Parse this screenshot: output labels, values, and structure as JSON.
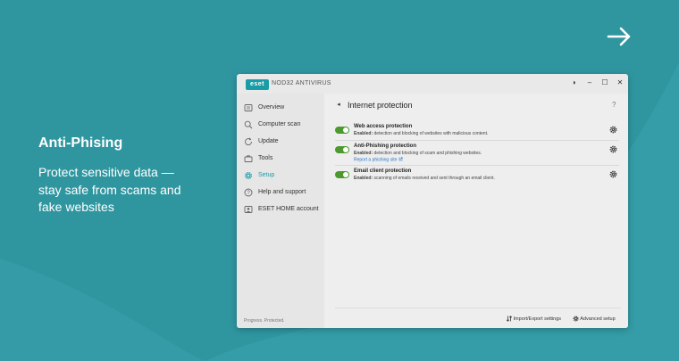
{
  "promo": {
    "title": "Anti-Phising",
    "text": "Protect sensitive data —stay safe from scams and fake websites"
  },
  "icons": {
    "next": "arrow-right-icon"
  },
  "app": {
    "logo": "eset",
    "product_name": "NOD32 ANTIVIRUS",
    "window_controls": [
      "◑",
      "–",
      "☐",
      "✕"
    ],
    "sidebar": {
      "items": [
        {
          "label": "Overview",
          "icon": "overview-icon",
          "active": false
        },
        {
          "label": "Computer scan",
          "icon": "search-icon",
          "active": false
        },
        {
          "label": "Update",
          "icon": "refresh-icon",
          "active": false
        },
        {
          "label": "Tools",
          "icon": "briefcase-icon",
          "active": false
        },
        {
          "label": "Setup",
          "icon": "gear-icon",
          "active": true
        },
        {
          "label": "Help and support",
          "icon": "question-icon",
          "active": false
        },
        {
          "label": "ESET HOME account",
          "icon": "account-icon",
          "active": false
        }
      ],
      "status": "Progress. Protected."
    },
    "main": {
      "back": "◂",
      "title": "Internet protection",
      "help": "?",
      "rows": [
        {
          "title": "Web access protection",
          "status": "Enabled:",
          "desc": "detection and blocking of websites with malicious content.",
          "link": "",
          "enabled": true
        },
        {
          "title": "Anti-Phishing protection",
          "status": "Enabled:",
          "desc": "detection and blocking of scam and phishing websites.",
          "link": "Report a phishing site",
          "enabled": true
        },
        {
          "title": "Email client protection",
          "status": "Enabled:",
          "desc": "scanning of emails received and sent through an email client.",
          "link": "",
          "enabled": true
        }
      ],
      "footer": {
        "import_export": "Import/Export settings",
        "advanced": "Advanced setup"
      }
    }
  },
  "colors": {
    "background": "#2f96a0",
    "accent": "#1a9ca7",
    "toggle_on": "#4c9a2e",
    "link": "#2276c9"
  }
}
